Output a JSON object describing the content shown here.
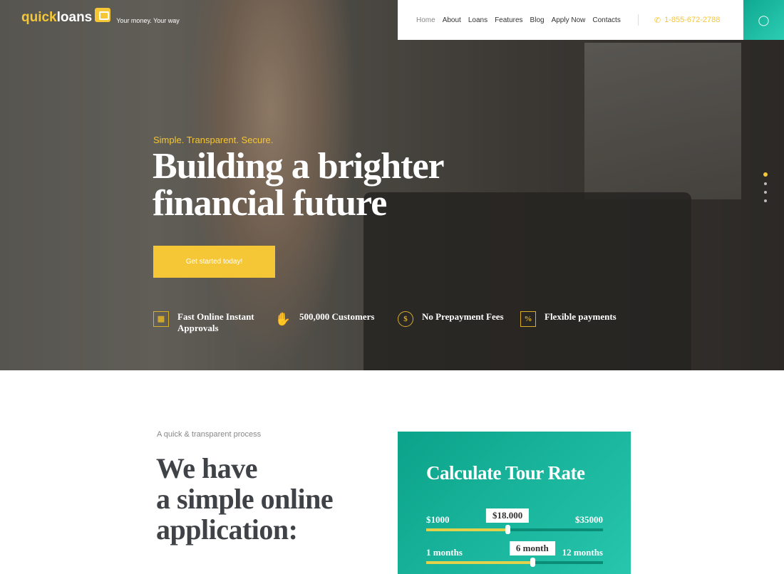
{
  "brand": {
    "name_part1": "quick",
    "name_part2": "loans",
    "tagline": "Your money. Your way"
  },
  "nav": {
    "items": [
      "Home",
      "About",
      "Loans",
      "Features",
      "Blog",
      "Apply Now",
      "Contacts"
    ],
    "active": "Home",
    "phone": "1-855-672-2788",
    "phone_icon": "phone-icon",
    "user_icon": "user-icon"
  },
  "colors": {
    "accent": "#f5c636",
    "teal": "#12b096"
  },
  "hero": {
    "kicker": "Simple. Transparent. Secure.",
    "title_line1": "Building a brighter",
    "title_line2": "financial future",
    "cta": "Get started today!",
    "slides_total": 4,
    "slide_active": 1,
    "features": [
      {
        "icon": "document-icon",
        "label": "Fast Online Instant Approvals"
      },
      {
        "icon": "handshake-icon",
        "label": "500,000 Customers"
      },
      {
        "icon": "dollar-coin-icon",
        "label": "No Prepayment Fees"
      },
      {
        "icon": "percent-scroll-icon",
        "label": "Flexible payments"
      }
    ]
  },
  "process": {
    "subtitle": "A quick & transparent process",
    "title_line1": "We have",
    "title_line2": "a simple online",
    "title_line3": "application:"
  },
  "calculator": {
    "title": "Calculate Tour Rate",
    "amount": {
      "min": "$1000",
      "max": "$35000",
      "value": "$18.000",
      "level": 0.46
    },
    "term": {
      "min": "1 months",
      "max": "12 months",
      "value": "6 month",
      "level": 0.6
    }
  }
}
